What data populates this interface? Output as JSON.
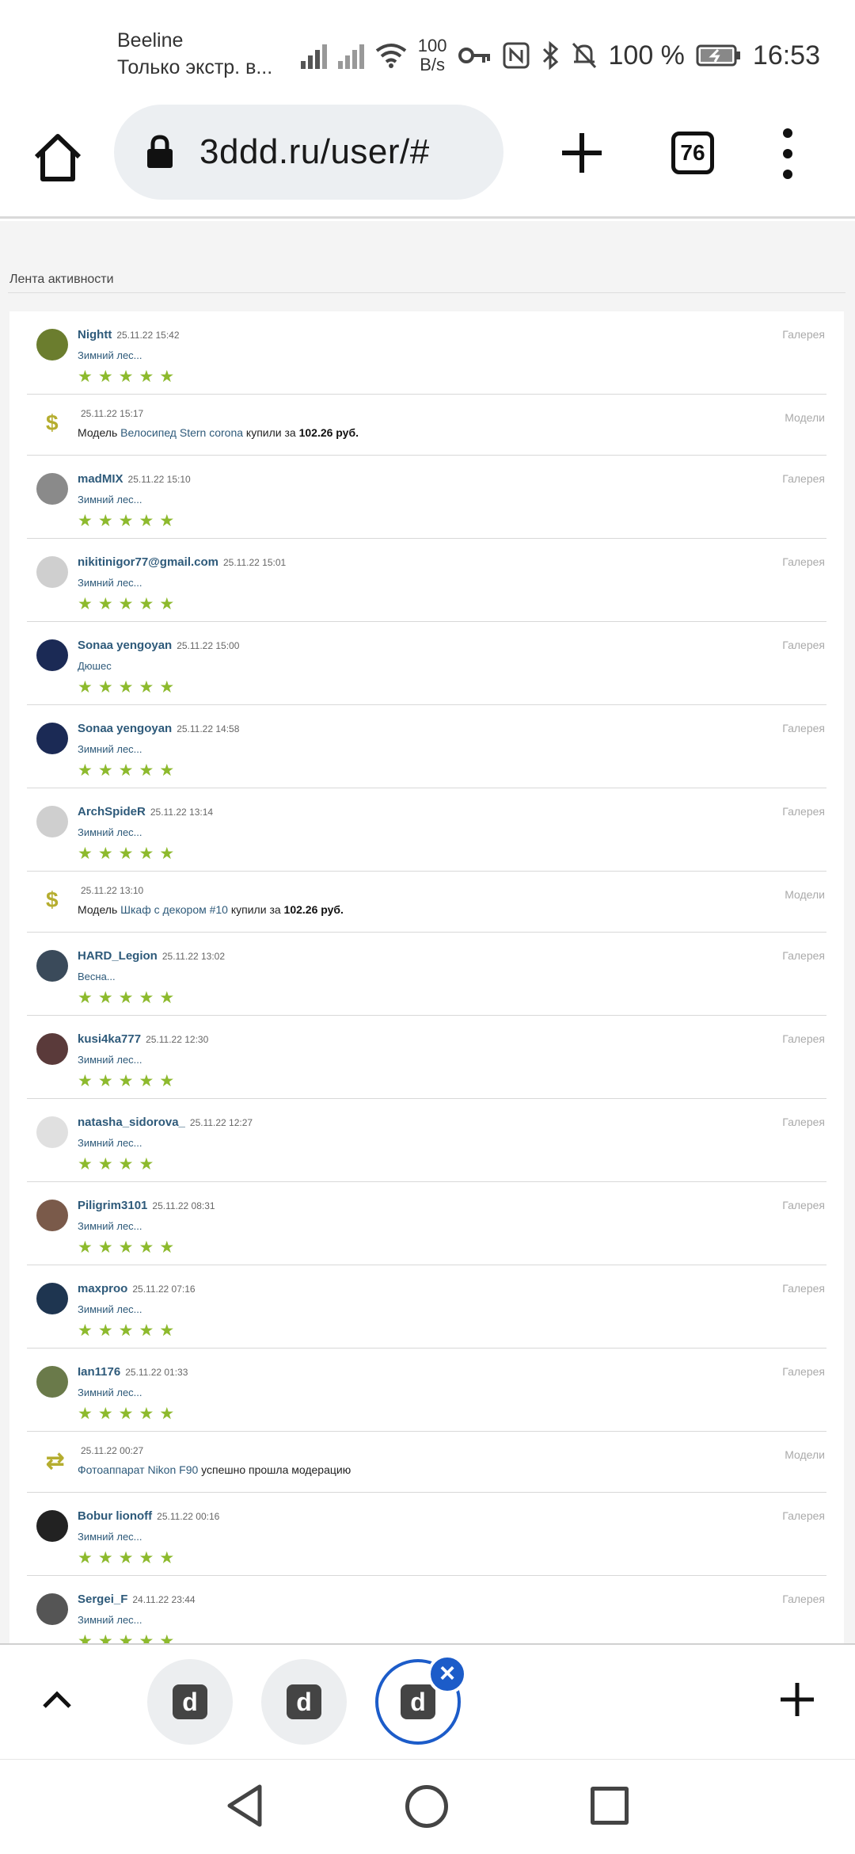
{
  "status_bar": {
    "carrier": "Beeline",
    "carrier_status": "Только экстр. в...",
    "net_speed_value": "100",
    "net_speed_unit": "B/s",
    "battery": "100 %",
    "time": "16:53"
  },
  "browser": {
    "url": "3ddd.ru/user/#",
    "tab_count": "76"
  },
  "feed": {
    "title": "Лента активности",
    "items": [
      {
        "type": "rated",
        "user": "Nightt",
        "time": "25.11.22 15:42",
        "work": "Зимний лес...",
        "category": "Галерея",
        "stars": 5,
        "avatar_color": "#6b7d2e"
      },
      {
        "type": "purchase",
        "time": "25.11.22 15:17",
        "category": "Модели",
        "symbol": "$",
        "prefix": "Модель",
        "link": "Велосипед Stern corona",
        "suffix": "купили за",
        "amount": "102.26 руб."
      },
      {
        "type": "rated",
        "user": "madMIX",
        "time": "25.11.22 15:10",
        "work": "Зимний лес...",
        "category": "Галерея",
        "stars": 5,
        "avatar_color": "#8a8a8a"
      },
      {
        "type": "rated",
        "user": "nikitinigor77@gmail.com",
        "time": "25.11.22 15:01",
        "work": "Зимний лес...",
        "category": "Галерея",
        "stars": 5,
        "avatar_color": "#cfcfcf"
      },
      {
        "type": "rated",
        "user": "Sonaa yengoyan",
        "time": "25.11.22 15:00",
        "work": "Дюшес",
        "category": "Галерея",
        "stars": 5,
        "avatar_color": "#1b2a55"
      },
      {
        "type": "rated",
        "user": "Sonaa yengoyan",
        "time": "25.11.22 14:58",
        "work": "Зимний лес...",
        "category": "Галерея",
        "stars": 5,
        "avatar_color": "#1b2a55"
      },
      {
        "type": "rated",
        "user": "ArchSpideR",
        "time": "25.11.22 13:14",
        "work": "Зимний лес...",
        "category": "Галерея",
        "stars": 5,
        "avatar_color": "#cfcfcf"
      },
      {
        "type": "purchase",
        "time": "25.11.22 13:10",
        "category": "Модели",
        "symbol": "$",
        "prefix": "Модель",
        "link": "Шкаф с декором #10",
        "suffix": "купили за",
        "amount": "102.26 руб."
      },
      {
        "type": "rated",
        "user": "HARD_Legion",
        "time": "25.11.22 13:02",
        "work": "Весна...",
        "category": "Галерея",
        "stars": 5,
        "avatar_color": "#3a4a5a"
      },
      {
        "type": "rated",
        "user": "kusi4ka777",
        "time": "25.11.22 12:30",
        "work": "Зимний лес...",
        "category": "Галерея",
        "stars": 5,
        "avatar_color": "#5a3a3a"
      },
      {
        "type": "rated",
        "user": "natasha_sidorova_",
        "time": "25.11.22 12:27",
        "work": "Зимний лес...",
        "category": "Галерея",
        "stars": 4,
        "avatar_color": "#e0e0e0"
      },
      {
        "type": "rated",
        "user": "Piligrim3101",
        "time": "25.11.22 08:31",
        "work": "Зимний лес...",
        "category": "Галерея",
        "stars": 5,
        "avatar_color": "#7a5a4a"
      },
      {
        "type": "rated",
        "user": "maxproo",
        "time": "25.11.22 07:16",
        "work": "Зимний лес...",
        "category": "Галерея",
        "stars": 5,
        "avatar_color": "#1e3550"
      },
      {
        "type": "rated",
        "user": "Ian1176",
        "time": "25.11.22 01:33",
        "work": "Зимний лес...",
        "category": "Галерея",
        "stars": 5,
        "avatar_color": "#6a7a4a"
      },
      {
        "type": "purchase",
        "time": "25.11.22 00:27",
        "category": "Модели",
        "symbol": "⇄",
        "prefix": "",
        "link": "Фотоаппарат Nikon F90",
        "suffix": "успешно прошла модерацию",
        "amount": ""
      },
      {
        "type": "rated",
        "user": "Bobur lionoff",
        "time": "25.11.22 00:16",
        "work": "Зимний лес...",
        "category": "Галерея",
        "stars": 5,
        "avatar_color": "#222222"
      },
      {
        "type": "rated",
        "user": "Sergei_F",
        "time": "24.11.22 23:44",
        "work": "Зимний лес...",
        "category": "Галерея",
        "stars": 5,
        "avatar_color": "#555555"
      }
    ]
  },
  "tab_strip": {
    "tab_logo": "d",
    "close_glyph": "×",
    "active_tab_index": 2
  },
  "colors": {
    "link": "#2e5a7a",
    "star": "#8dba2d",
    "accent": "#1c5cc9"
  }
}
